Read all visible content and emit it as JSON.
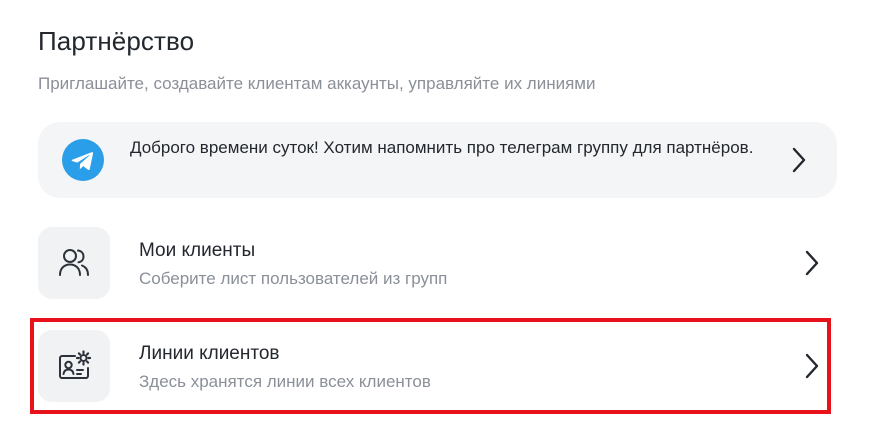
{
  "header": {
    "title": "Партнёрство",
    "subtitle": "Приглашайте, создавайте клиентам аккаунты, управляйте их линиями"
  },
  "banner": {
    "icon": "telegram-icon",
    "text": "Доброго времени суток! Хотим напомнить про телеграм группу для партнёров.",
    "arrow_icon": "chevron-right-icon"
  },
  "items": [
    {
      "icon": "users-icon",
      "title": "Мои клиенты",
      "description": "Соберите лист пользователей из групп",
      "arrow_icon": "chevron-right-icon"
    },
    {
      "icon": "id-card-settings-icon",
      "title": "Линии клиентов",
      "description": "Здесь хранятся линии всех клиентов",
      "arrow_icon": "chevron-right-icon"
    }
  ],
  "colors": {
    "telegram_blue": "#2a9ee8",
    "highlight_red": "#e8121b",
    "muted_text": "#8a8f98",
    "card_bg": "#f4f5f7"
  }
}
